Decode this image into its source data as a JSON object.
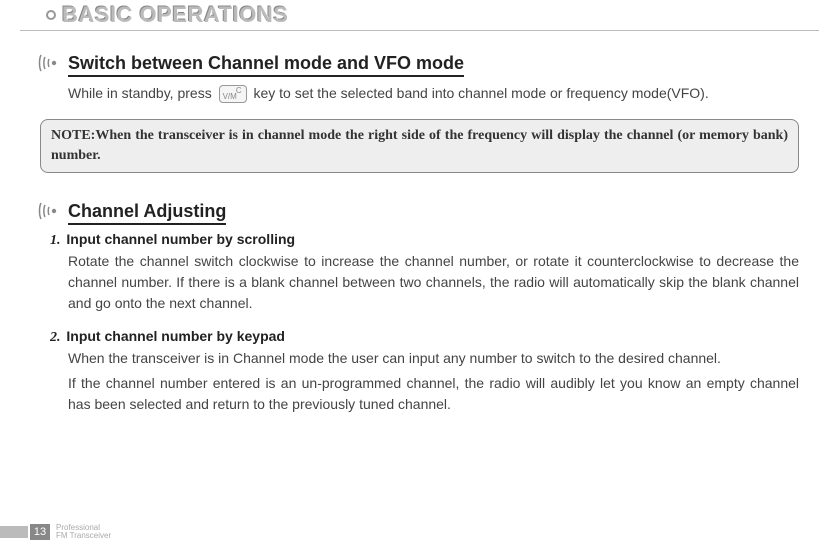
{
  "chapter": {
    "title": "BASIC OPERATIONS"
  },
  "section1": {
    "title": "Switch between Channel mode and VFO mode",
    "body_pre": "While in standby, press ",
    "body_post": " key to set the selected band into channel mode or frequency mode(VFO).",
    "key_label": "V/M"
  },
  "note": {
    "text": "NOTE:When the transceiver is in channel mode the right side of the frequency will display the channel (or memory bank) number."
  },
  "section2": {
    "title": "Channel Adjusting",
    "items": [
      {
        "num": "1.",
        "head": "Input channel number by scrolling",
        "body": "Rotate the channel switch clockwise to increase the channel number, or rotate it counterclockwise to decrease the channel number. If there is a blank channel between two channels, the radio will automatically skip the blank channel and go onto the next channel."
      },
      {
        "num": "2.",
        "head": "Input channel number by keypad",
        "body": "When the transceiver is in Channel mode the user can input any number to switch to the desired channel.",
        "body2": "If the channel number entered is an un-programmed channel, the radio will audibly let you know an empty channel has been selected and return to the previously tuned channel."
      }
    ]
  },
  "footer": {
    "page": "13",
    "line1": "Professional",
    "line2": "FM Transceiver"
  }
}
